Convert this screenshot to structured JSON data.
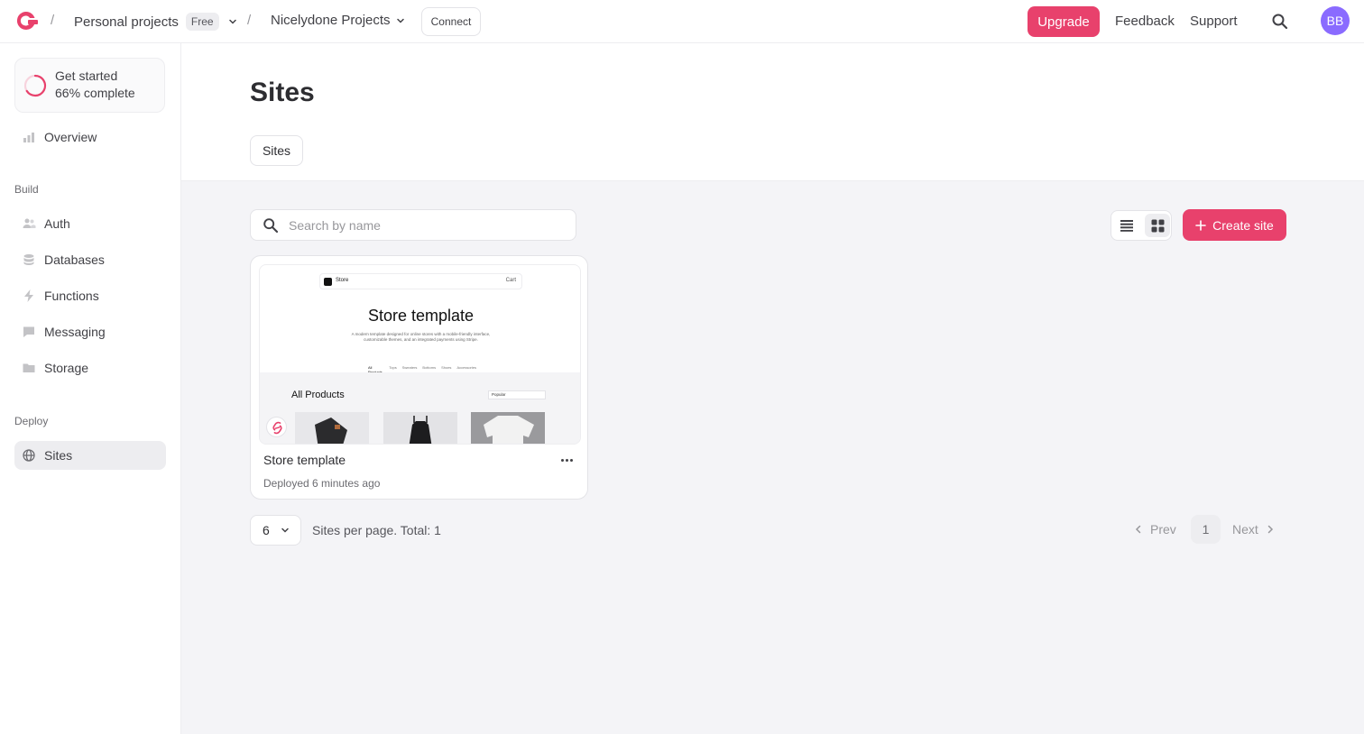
{
  "topbar": {
    "org_name": "Personal projects",
    "plan_badge": "Free",
    "project_name": "Nicelydone Projects",
    "connect_label": "Connect",
    "upgrade_label": "Upgrade",
    "feedback_label": "Feedback",
    "support_label": "Support",
    "avatar_initials": "BB",
    "breadcrumb_separator": "/"
  },
  "sidebar": {
    "get_started": {
      "title": "Get started",
      "progress_text": "66% complete",
      "progress": 0.66
    },
    "overview_label": "Overview",
    "build_heading": "Build",
    "build_items": [
      {
        "label": "Auth",
        "icon": "users-icon"
      },
      {
        "label": "Databases",
        "icon": "database-icon"
      },
      {
        "label": "Functions",
        "icon": "lightning-icon"
      },
      {
        "label": "Messaging",
        "icon": "chat-icon"
      },
      {
        "label": "Storage",
        "icon": "folder-icon"
      }
    ],
    "deploy_heading": "Deploy",
    "deploy_items": [
      {
        "label": "Sites",
        "icon": "globe-icon",
        "active": true
      }
    ]
  },
  "main": {
    "title": "Sites",
    "tabs": [
      {
        "label": "Sites",
        "active": true
      }
    ],
    "search": {
      "placeholder": "Search by name",
      "value": ""
    },
    "view_mode": "grid",
    "create_label": "Create site",
    "sites": [
      {
        "name": "Store template",
        "status": "Deployed 6 minutes ago",
        "preview": {
          "nav_brand": "Store",
          "nav_cart": "Cart",
          "hero_title": "Store template",
          "hero_desc": "A modern template designed for online stores with a mobile-friendly interface, customizable themes, and an integrated payments using Stripe.",
          "categories": [
            "All Products",
            "Tops",
            "Sweaters",
            "Bottoms",
            "Shoes",
            "Accessories"
          ],
          "section_title": "All Products",
          "sort_value": "Popular"
        }
      }
    ],
    "pagination": {
      "per_page": "6",
      "summary": "Sites per page. Total: 1",
      "prev_label": "Prev",
      "current_page": "1",
      "next_label": "Next"
    }
  },
  "colors": {
    "accent": "#e8416c",
    "avatar_bg": "#8a6bff",
    "content_bg": "#f4f4f7"
  }
}
